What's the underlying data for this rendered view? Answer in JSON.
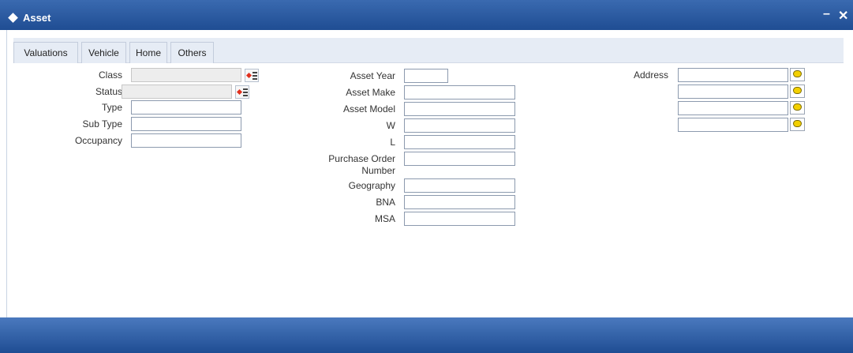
{
  "window": {
    "title": "Asset",
    "minimize": "–",
    "close": "✕"
  },
  "tabs": [
    "Valuations",
    "Vehicle",
    "Home",
    "Others"
  ],
  "left_fields": {
    "class": "Class",
    "status": "Status",
    "type": "Type",
    "sub_type": "Sub Type",
    "occupancy": "Occupancy"
  },
  "mid_fields": {
    "asset_year": "Asset Year",
    "asset_make": "Asset Make",
    "asset_model": "Asset Model",
    "w": "W",
    "l": "L",
    "purchase_order_line1": "Purchase Order",
    "purchase_order_line2": "Number",
    "geography": "Geography",
    "bna": "BNA",
    "msa": "MSA"
  },
  "right_fields": {
    "address": "Address"
  },
  "icons": {
    "lov": "list-of-values-icon",
    "note": "note-bubble-icon",
    "title": "diamond-icon"
  },
  "colors": {
    "header": "#1f4d93",
    "tab_bg": "#e6ecf5"
  }
}
